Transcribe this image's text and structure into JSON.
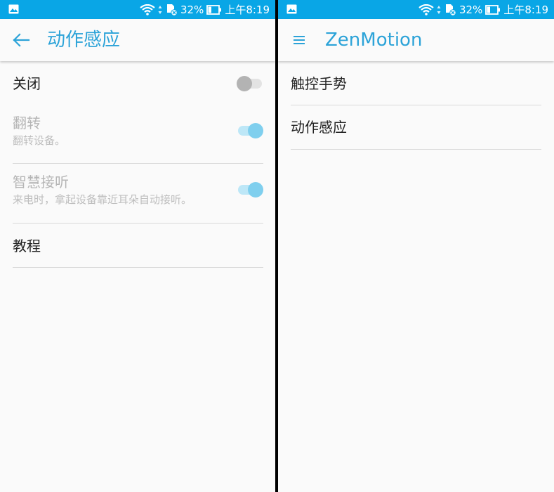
{
  "status_bar": {
    "image_icon": "image-notification-icon",
    "wifi_icon": "wifi-icon",
    "sd_icon": "sd-card-error-icon",
    "battery_percent": "32%",
    "battery_level": 0.32,
    "time": "上午8:19"
  },
  "left_panel": {
    "nav_icon": "back-arrow-icon",
    "title": "动作感应",
    "master_switch": {
      "label": "关闭",
      "state": "off"
    },
    "items": [
      {
        "title": "翻转",
        "subtitle": "翻转设备。",
        "state": "on",
        "enabled": false
      },
      {
        "title": "智慧接听",
        "subtitle": "来电时，拿起设备靠近耳朵自动接听。",
        "state": "on",
        "enabled": false
      },
      {
        "title": "教程"
      }
    ]
  },
  "right_panel": {
    "nav_icon": "menu-icon",
    "title": "ZenMotion",
    "items": [
      {
        "title": "触控手势"
      },
      {
        "title": "动作感应"
      }
    ]
  },
  "colors": {
    "status_bar": "#09a6e6",
    "accent": "#2ca3d8",
    "toggle_on_thumb": "#7fcfee",
    "toggle_off_thumb": "#b3b3b3"
  }
}
